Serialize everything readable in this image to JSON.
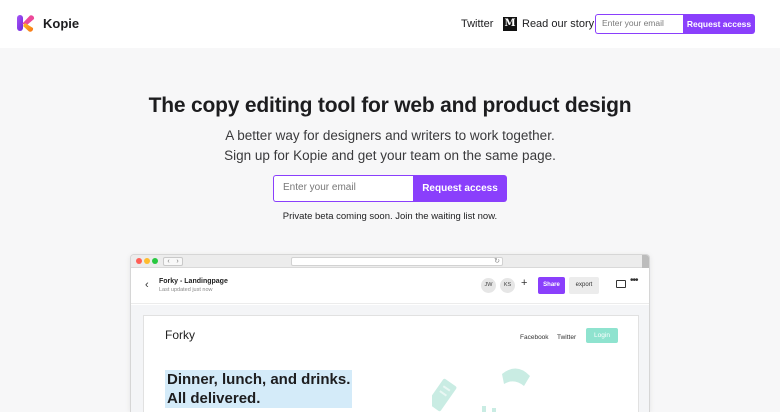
{
  "nav": {
    "brand": "Kopie",
    "links": [
      "Twitter",
      "Read our story"
    ],
    "medium_glyph": "M",
    "email_placeholder": "Enter your email",
    "cta": "Request access"
  },
  "hero": {
    "title": "The copy editing tool for web and product design",
    "subtitle": "A better way for designers and writers to work together. Sign up for Kopie and get your team on the same page.",
    "email_placeholder": "Enter your email",
    "cta": "Request access",
    "note": "Private beta coming soon. Join the waiting list now."
  },
  "mockup": {
    "doc_title": "Forky - Landingpage",
    "doc_subtitle": "Last updated just now",
    "avatars": [
      "JW",
      "KS"
    ],
    "share": "Share",
    "export": "export",
    "site": {
      "brand": "Forky",
      "links": [
        "Facebook",
        "Twitter"
      ],
      "login": "Login",
      "headline": [
        "Dinner, lunch, and drinks.",
        "All delivered."
      ]
    }
  },
  "colors": {
    "accent": "#8a3ffc",
    "hero_bg": "#f7f7f8",
    "mint": "#8fe3cf",
    "highlight": "#d4ebf9"
  },
  "icons": [
    "kopie-logo-icon",
    "medium-logo-icon",
    "back-arrow-icon",
    "plus-icon",
    "comment-icon",
    "more-icon",
    "reload-icon"
  ]
}
